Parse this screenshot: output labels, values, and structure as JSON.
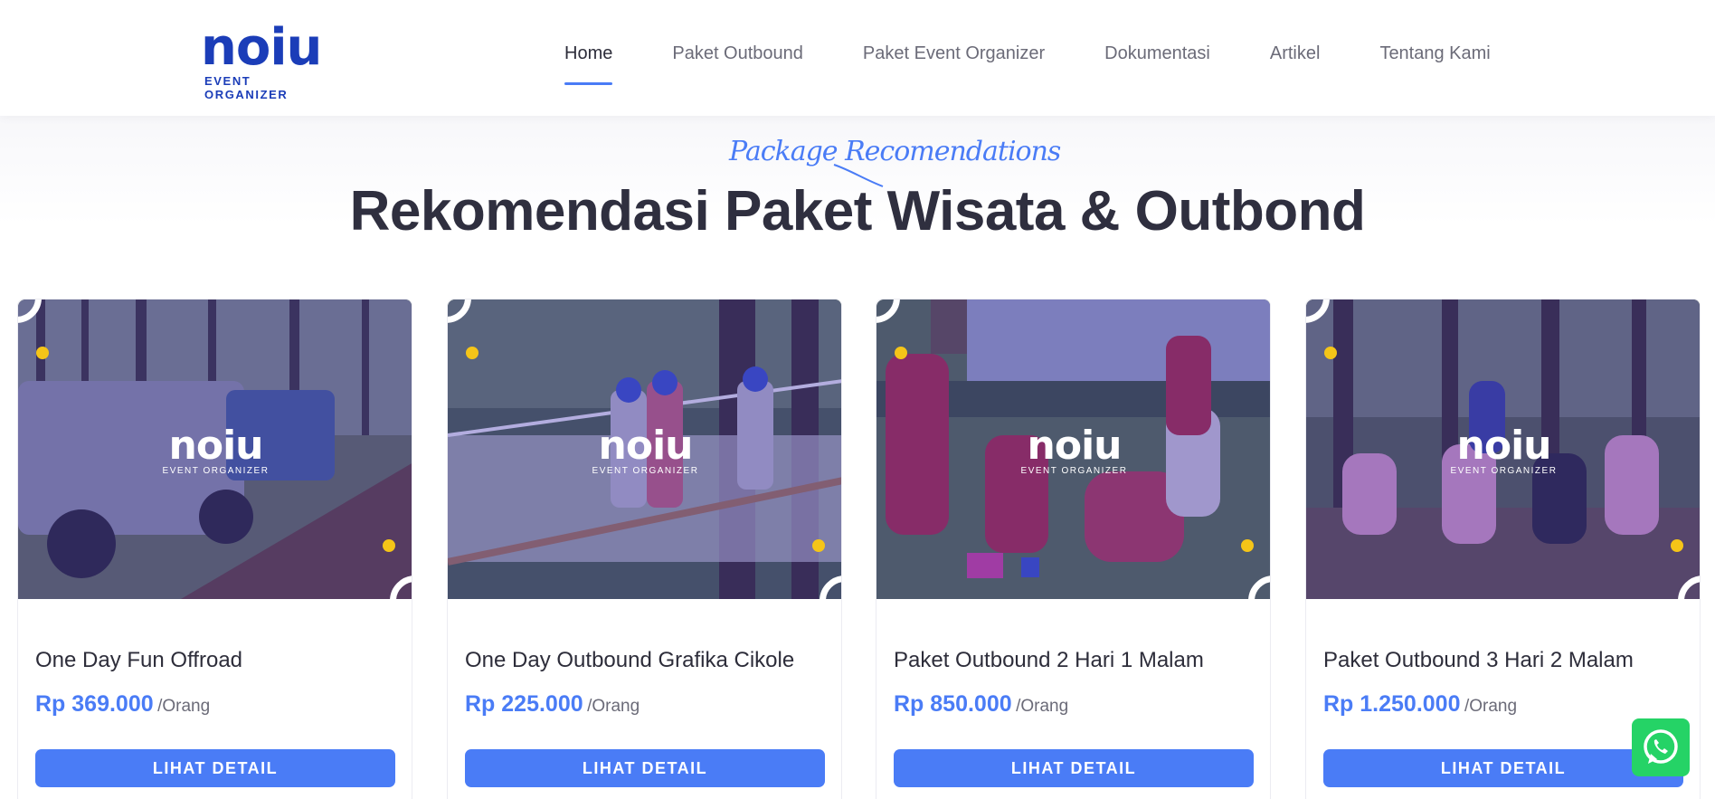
{
  "header": {
    "logo": {
      "word": "noiu",
      "sub": "EVENT ORGANIZER"
    },
    "nav": [
      {
        "label": "Home",
        "active": true
      },
      {
        "label": "Paket Outbound",
        "active": false
      },
      {
        "label": "Paket Event Organizer",
        "active": false
      },
      {
        "label": "Dokumentasi",
        "active": false
      },
      {
        "label": "Artikel",
        "active": false
      },
      {
        "label": "Tentang Kami",
        "active": false
      }
    ]
  },
  "section": {
    "script_label": "Package Recomendations",
    "title": "Rekomendasi Paket Wisata & Outbond"
  },
  "cards": [
    {
      "title": "One Day Fun Offroad",
      "price": "Rp 369.000",
      "unit": "/Orang",
      "button": "LIHAT DETAIL",
      "watermark_word": "noiu",
      "watermark_sub": "EVENT ORGANIZER"
    },
    {
      "title": "One Day Outbound Grafika Cikole",
      "price": "Rp 225.000",
      "unit": "/Orang",
      "button": "LIHAT DETAIL",
      "watermark_word": "noiu",
      "watermark_sub": "EVENT ORGANIZER"
    },
    {
      "title": "Paket Outbound 2 Hari 1 Malam",
      "price": "Rp 850.000",
      "unit": "/Orang",
      "button": "LIHAT DETAIL",
      "watermark_word": "noiu",
      "watermark_sub": "EVENT ORGANIZER"
    },
    {
      "title": "Paket Outbound 3 Hari 2 Malam",
      "price": "Rp 1.250.000",
      "unit": "/Orang",
      "button": "LIHAT DETAIL",
      "watermark_word": "noiu",
      "watermark_sub": "EVENT ORGANIZER"
    }
  ],
  "colors": {
    "accent": "#4a7cf6",
    "brand": "#1b3db8",
    "dot": "#f5c518",
    "whatsapp": "#25d366"
  },
  "icons": {
    "chat": "whatsapp-icon"
  }
}
